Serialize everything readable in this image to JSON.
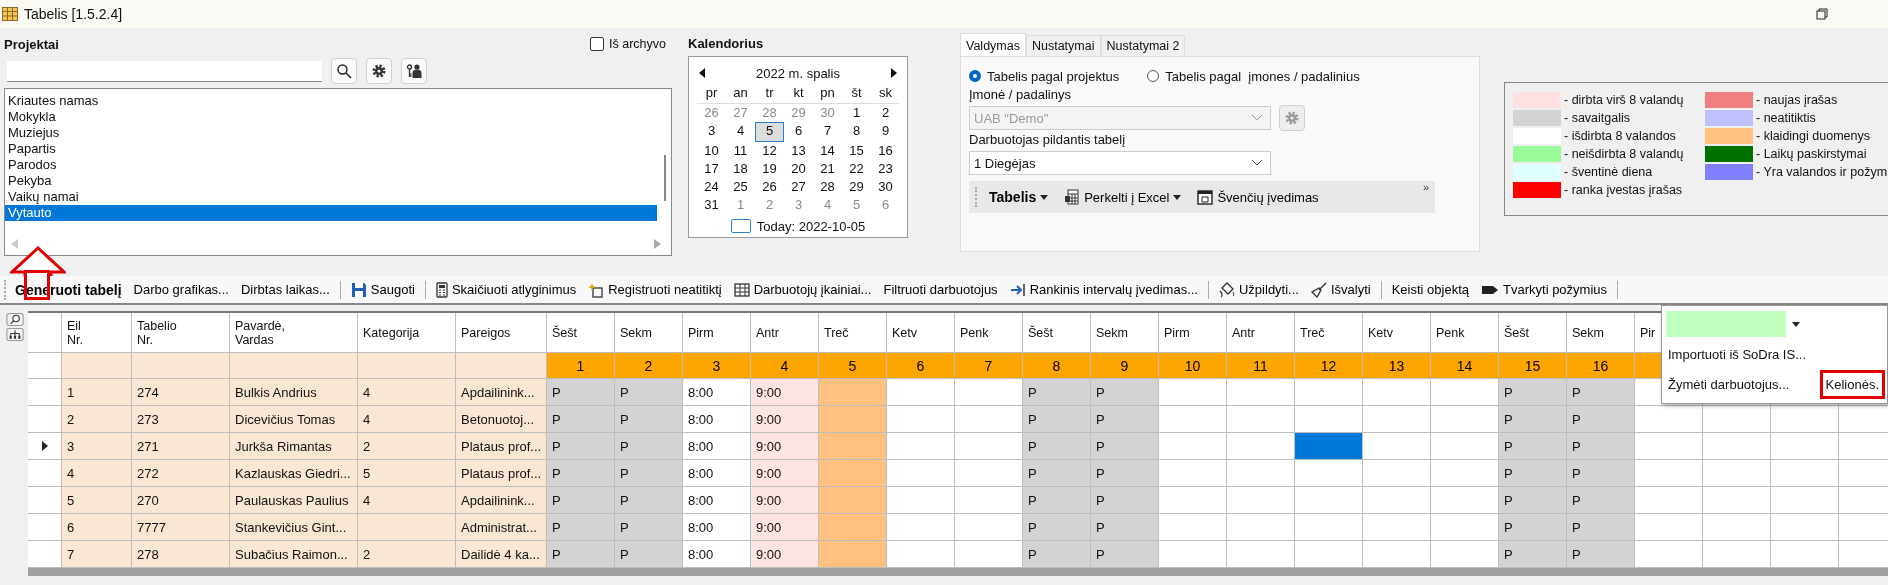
{
  "window": {
    "title": "Tabelis [1.5.2.4]"
  },
  "projects": {
    "title": "Projektai",
    "archive": {
      "label": "Iš archyvo",
      "checked": false
    },
    "items": [
      {
        "label": "Kriautes namas",
        "selected": false
      },
      {
        "label": "Mokykla",
        "selected": false
      },
      {
        "label": "Muziejus",
        "selected": false
      },
      {
        "label": "Papartis",
        "selected": false
      },
      {
        "label": "Parodos",
        "selected": false
      },
      {
        "label": "Pekyba",
        "selected": false
      },
      {
        "label": "Vaikų namai",
        "selected": false
      },
      {
        "label": "Vytauto",
        "selected": true
      }
    ]
  },
  "calendar": {
    "title": "Kalendorius",
    "month": "2022 m. spalis",
    "weekdays": [
      "pr",
      "an",
      "tr",
      "kt",
      "pn",
      "št",
      "sk"
    ],
    "weeks": [
      [
        {
          "day": "26",
          "other": true,
          "selected": false
        },
        {
          "day": "27",
          "other": true,
          "selected": false
        },
        {
          "day": "28",
          "other": true,
          "selected": false
        },
        {
          "day": "29",
          "other": true,
          "selected": false
        },
        {
          "day": "30",
          "other": true,
          "selected": false
        },
        {
          "day": "1",
          "other": false,
          "selected": false
        },
        {
          "day": "2",
          "other": false,
          "selected": false
        }
      ],
      [
        {
          "day": "3",
          "other": false,
          "selected": false
        },
        {
          "day": "4",
          "other": false,
          "selected": false
        },
        {
          "day": "5",
          "other": false,
          "selected": true
        },
        {
          "day": "6",
          "other": false,
          "selected": false
        },
        {
          "day": "7",
          "other": false,
          "selected": false
        },
        {
          "day": "8",
          "other": false,
          "selected": false
        },
        {
          "day": "9",
          "other": false,
          "selected": false
        }
      ],
      [
        {
          "day": "10",
          "other": false,
          "selected": false
        },
        {
          "day": "11",
          "other": false,
          "selected": false
        },
        {
          "day": "12",
          "other": false,
          "selected": false
        },
        {
          "day": "13",
          "other": false,
          "selected": false
        },
        {
          "day": "14",
          "other": false,
          "selected": false
        },
        {
          "day": "15",
          "other": false,
          "selected": false
        },
        {
          "day": "16",
          "other": false,
          "selected": false
        }
      ],
      [
        {
          "day": "17",
          "other": false,
          "selected": false
        },
        {
          "day": "18",
          "other": false,
          "selected": false
        },
        {
          "day": "19",
          "other": false,
          "selected": false
        },
        {
          "day": "20",
          "other": false,
          "selected": false
        },
        {
          "day": "21",
          "other": false,
          "selected": false
        },
        {
          "day": "22",
          "other": false,
          "selected": false
        },
        {
          "day": "23",
          "other": false,
          "selected": false
        }
      ],
      [
        {
          "day": "24",
          "other": false,
          "selected": false
        },
        {
          "day": "25",
          "other": false,
          "selected": false
        },
        {
          "day": "26",
          "other": false,
          "selected": false
        },
        {
          "day": "27",
          "other": false,
          "selected": false
        },
        {
          "day": "28",
          "other": false,
          "selected": false
        },
        {
          "day": "29",
          "other": false,
          "selected": false
        },
        {
          "day": "30",
          "other": false,
          "selected": false
        }
      ],
      [
        {
          "day": "31",
          "other": false,
          "selected": false
        },
        {
          "day": "1",
          "other": true,
          "selected": false
        },
        {
          "day": "2",
          "other": true,
          "selected": false
        },
        {
          "day": "3",
          "other": true,
          "selected": false
        },
        {
          "day": "4",
          "other": true,
          "selected": false
        },
        {
          "day": "5",
          "other": true,
          "selected": false
        },
        {
          "day": "6",
          "other": true,
          "selected": false
        }
      ]
    ],
    "today": "Today: 2022-10-05"
  },
  "control": {
    "tabs": [
      {
        "label": "Valdymas",
        "selected": true
      },
      {
        "label": "Nustatymai",
        "selected": false
      },
      {
        "label": "Nustatymai 2",
        "selected": false
      }
    ],
    "radios": [
      {
        "label": "Tabelis pagal projektus",
        "selected": true
      },
      {
        "label": "Tabelis pagal  įmones / padalinius",
        "selected": false
      }
    ],
    "company": {
      "label": "Įmonė / padalinys",
      "value": "UAB \"Demo\"",
      "disabled": true
    },
    "employee": {
      "label": "Darbuotojas pildantis tabelį",
      "value": "1 Diegėjas",
      "disabled": false
    },
    "toolbar": [
      {
        "label": "Tabelis",
        "kind": "bold-menu"
      },
      {
        "label": "Perkelti į Excel",
        "kind": "menu"
      },
      {
        "label": "Švenčių įvedimas",
        "kind": "button"
      }
    ],
    "overflow": "»"
  },
  "legend": [
    {
      "label": "- dirbta virš 8 valandų",
      "color": "#ffe0e0"
    },
    {
      "label": "- savaitgalis",
      "color": "#d3d3d3"
    },
    {
      "label": "- išdirbta 8 valandos",
      "color": "#ffffff"
    },
    {
      "label": "- neišdirbta 8 valandų",
      "color": "#98fb98"
    },
    {
      "label": "- šventinė diena",
      "color": "#e0ffff"
    },
    {
      "label": "- ranka įvestas įrašas",
      "color": "#ff0000"
    },
    {
      "label": "- naujas įrašas",
      "color": "#f08080"
    },
    {
      "label": "- neatitiktis",
      "color": "#c0c0ff"
    },
    {
      "label": "- klaidingi duomenys",
      "color": "#ffc080"
    },
    {
      "label": "- Laikų paskirstymai",
      "color": "#007000"
    },
    {
      "label": "- Yra valandos ir požym",
      "color": "#8080ff"
    }
  ],
  "toolbar": [
    {
      "kind": "bold",
      "label": "Generuoti tabelį"
    },
    {
      "kind": "button",
      "label": "Darbo grafikas..."
    },
    {
      "kind": "button",
      "label": "Dirbtas laikas..."
    },
    {
      "kind": "separator"
    },
    {
      "kind": "button",
      "label": "Saugoti"
    },
    {
      "kind": "separator"
    },
    {
      "kind": "button",
      "label": "Skaičiuoti atlyginimus"
    },
    {
      "kind": "button",
      "label": "Registruoti neatitiktį"
    },
    {
      "kind": "button",
      "label": "Darbuotojų įkainiai..."
    },
    {
      "kind": "button",
      "label": "Filtruoti darbuotojus"
    },
    {
      "kind": "button",
      "label": "Rankinis intervalų įvedimas..."
    },
    {
      "kind": "separator"
    },
    {
      "kind": "button",
      "label": "Užpildyti..."
    },
    {
      "kind": "button",
      "label": "Išvalyti"
    },
    {
      "kind": "separator"
    },
    {
      "kind": "button",
      "label": "Keisti objektą"
    },
    {
      "kind": "button",
      "label": "Tvarkyti požymius"
    },
    {
      "kind": "separator"
    }
  ],
  "table": {
    "columns": [
      "Eil\nNr.",
      "Tabelio\nNr.",
      "Pavardė,\nVardas",
      "Kategorija",
      "Pareigos"
    ],
    "days": [
      {
        "weekday": "Šešt",
        "number": "1"
      },
      {
        "weekday": "Sekm",
        "number": "2"
      },
      {
        "weekday": "Pirm",
        "number": "3"
      },
      {
        "weekday": "Antr",
        "number": "4"
      },
      {
        "weekday": "Treč",
        "number": "5"
      },
      {
        "weekday": "Ketv",
        "number": "6"
      },
      {
        "weekday": "Penk",
        "number": "7"
      },
      {
        "weekday": "Šešt",
        "number": "8"
      },
      {
        "weekday": "Sekm",
        "number": "9"
      },
      {
        "weekday": "Pirm",
        "number": "10"
      },
      {
        "weekday": "Antr",
        "number": "11"
      },
      {
        "weekday": "Treč",
        "number": "12"
      },
      {
        "weekday": "Ketv",
        "number": "13"
      },
      {
        "weekday": "Penk",
        "number": "14"
      },
      {
        "weekday": "Šešt",
        "number": "15"
      },
      {
        "weekday": "Sekm",
        "number": "16"
      },
      {
        "weekday": "Pir"
      }
    ],
    "rows": [
      {
        "current": false,
        "no": "1",
        "tab": "274",
        "name": "Bulkis Andrius",
        "category": "4",
        "position": "Apdailinink...",
        "cells": [
          {
            "value": "P",
            "kind": "weekend"
          },
          {
            "value": "P",
            "kind": "weekend"
          },
          {
            "value": "8:00",
            "kind": "normal"
          },
          {
            "value": "9:00",
            "kind": "over"
          },
          {
            "kind": "error"
          },
          {
            "kind": "normal"
          },
          {
            "kind": "normal"
          },
          {
            "value": "P",
            "kind": "weekend"
          },
          {
            "value": "P",
            "kind": "weekend"
          },
          {
            "kind": "normal"
          },
          {
            "kind": "normal"
          },
          {
            "kind": "normal"
          },
          {
            "kind": "normal"
          },
          {
            "kind": "normal"
          },
          {
            "value": "P",
            "kind": "weekend"
          },
          {
            "value": "P",
            "kind": "weekend"
          }
        ]
      },
      {
        "current": false,
        "no": "2",
        "tab": "273",
        "name": "Dicevičius Tomas",
        "category": "4",
        "position": "Betonuotoj...",
        "cells": [
          {
            "value": "P",
            "kind": "weekend"
          },
          {
            "value": "P",
            "kind": "weekend"
          },
          {
            "value": "8:00",
            "kind": "normal"
          },
          {
            "value": "9:00",
            "kind": "over"
          },
          {
            "kind": "error"
          },
          {
            "kind": "normal"
          },
          {
            "kind": "normal"
          },
          {
            "value": "P",
            "kind": "weekend"
          },
          {
            "value": "P",
            "kind": "weekend"
          },
          {
            "kind": "normal"
          },
          {
            "kind": "normal"
          },
          {
            "kind": "normal"
          },
          {
            "kind": "normal"
          },
          {
            "kind": "normal"
          },
          {
            "value": "P",
            "kind": "weekend"
          },
          {
            "value": "P",
            "kind": "weekend"
          }
        ]
      },
      {
        "current": true,
        "no": "3",
        "tab": "271",
        "name": "Jurkša Rimantas",
        "category": "2",
        "position": "Plataus prof...",
        "cells": [
          {
            "value": "P",
            "kind": "weekend"
          },
          {
            "value": "P",
            "kind": "weekend"
          },
          {
            "value": "8:00",
            "kind": "normal"
          },
          {
            "value": "9:00",
            "kind": "over"
          },
          {
            "kind": "error"
          },
          {
            "kind": "normal"
          },
          {
            "kind": "normal"
          },
          {
            "value": "P",
            "kind": "weekend"
          },
          {
            "value": "P",
            "kind": "weekend"
          },
          {
            "kind": "normal"
          },
          {
            "kind": "normal"
          },
          {
            "kind": "selected"
          },
          {
            "kind": "normal"
          },
          {
            "kind": "normal"
          },
          {
            "value": "P",
            "kind": "weekend"
          },
          {
            "value": "P",
            "kind": "weekend"
          }
        ]
      },
      {
        "current": false,
        "no": "4",
        "tab": "272",
        "name": "Kazlauskas Giedri...",
        "category": "5",
        "position": "Plataus prof...",
        "cells": [
          {
            "value": "P",
            "kind": "weekend"
          },
          {
            "value": "P",
            "kind": "weekend"
          },
          {
            "value": "8:00",
            "kind": "normal"
          },
          {
            "value": "9:00",
            "kind": "over"
          },
          {
            "kind": "error"
          },
          {
            "kind": "normal"
          },
          {
            "kind": "normal"
          },
          {
            "value": "P",
            "kind": "weekend"
          },
          {
            "value": "P",
            "kind": "weekend"
          },
          {
            "kind": "normal"
          },
          {
            "kind": "normal"
          },
          {
            "kind": "normal"
          },
          {
            "kind": "normal"
          },
          {
            "kind": "normal"
          },
          {
            "value": "P",
            "kind": "weekend"
          },
          {
            "value": "P",
            "kind": "weekend"
          }
        ]
      },
      {
        "current": false,
        "no": "5",
        "tab": "270",
        "name": "Paulauskas Paulius",
        "category": "4",
        "position": "Apdailinink...",
        "cells": [
          {
            "value": "P",
            "kind": "weekend"
          },
          {
            "value": "P",
            "kind": "weekend"
          },
          {
            "value": "8:00",
            "kind": "normal"
          },
          {
            "value": "9:00",
            "kind": "over"
          },
          {
            "kind": "error"
          },
          {
            "kind": "normal"
          },
          {
            "kind": "normal"
          },
          {
            "value": "P",
            "kind": "weekend"
          },
          {
            "value": "P",
            "kind": "weekend"
          },
          {
            "kind": "normal"
          },
          {
            "kind": "normal"
          },
          {
            "kind": "normal"
          },
          {
            "kind": "normal"
          },
          {
            "kind": "normal"
          },
          {
            "value": "P",
            "kind": "weekend"
          },
          {
            "value": "P",
            "kind": "weekend"
          }
        ]
      },
      {
        "current": false,
        "no": "6",
        "tab": "7777",
        "name": "Stankevičius Gint...",
        "position": "Administrat...",
        "cells": [
          {
            "value": "P",
            "kind": "weekend"
          },
          {
            "value": "P",
            "kind": "weekend"
          },
          {
            "value": "8:00",
            "kind": "normal"
          },
          {
            "value": "9:00",
            "kind": "over"
          },
          {
            "kind": "error"
          },
          {
            "kind": "normal"
          },
          {
            "kind": "normal"
          },
          {
            "value": "P",
            "kind": "weekend"
          },
          {
            "value": "P",
            "kind": "weekend"
          },
          {
            "kind": "normal"
          },
          {
            "kind": "normal"
          },
          {
            "kind": "normal"
          },
          {
            "kind": "normal"
          },
          {
            "kind": "normal"
          },
          {
            "value": "P",
            "kind": "weekend"
          },
          {
            "value": "P",
            "kind": "weekend"
          }
        ]
      },
      {
        "current": false,
        "no": "7",
        "tab": "278",
        "name": "Subačius Raimon...",
        "category": "2",
        "position": "Dailidė 4 ka...",
        "cells": [
          {
            "value": "P",
            "kind": "weekend"
          },
          {
            "value": "P",
            "kind": "weekend"
          },
          {
            "value": "8:00",
            "kind": "normal"
          },
          {
            "value": "9:00",
            "kind": "over"
          },
          {
            "kind": "error"
          },
          {
            "kind": "normal"
          },
          {
            "kind": "normal"
          },
          {
            "value": "P",
            "kind": "weekend"
          },
          {
            "value": "P",
            "kind": "weekend"
          },
          {
            "kind": "normal"
          },
          {
            "kind": "normal"
          },
          {
            "kind": "normal"
          },
          {
            "kind": "normal"
          },
          {
            "kind": "normal"
          },
          {
            "value": "P",
            "kind": "weekend"
          },
          {
            "value": "P",
            "kind": "weekend"
          }
        ]
      }
    ]
  },
  "popup": {
    "rows": [
      [
        "Importuoti iš SoDra IS..."
      ],
      [
        "Žymėti darbuotojus...",
        "Kelionės."
      ]
    ]
  }
}
